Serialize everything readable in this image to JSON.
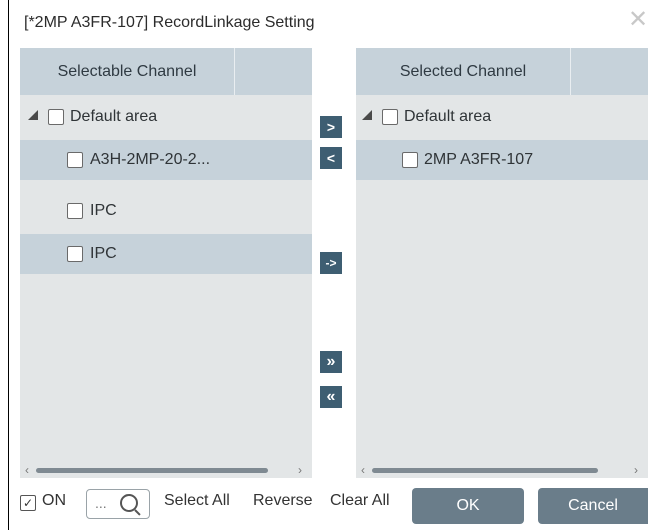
{
  "window": {
    "title": "[*2MP A3FR-107] RecordLinkage Setting",
    "close_glyph": "✕"
  },
  "left_panel": {
    "header": "Selectable Channel",
    "items": [
      {
        "label": "Default area"
      },
      {
        "label": "A3H-2MP-20-2..."
      },
      {
        "label": "IPC"
      },
      {
        "label": "IPC"
      }
    ]
  },
  "right_panel": {
    "header": "Selected Channel",
    "items": [
      {
        "label": "Default area"
      },
      {
        "label": "2MP A3FR-107"
      }
    ]
  },
  "middle_buttons": {
    "add": ">",
    "remove": "<",
    "move": "->",
    "add_all": "»",
    "remove_all": "«"
  },
  "footer": {
    "on_label": "ON",
    "search_placeholder": "...",
    "select_all": "Select All",
    "reverse": "Reverse",
    "clear_all": "Clear All",
    "ok": "OK",
    "cancel": "Cancel"
  },
  "icons": {
    "scroll_left": "‹",
    "scroll_right": "›",
    "check": "✓"
  },
  "colors": {
    "header_bg": "#c6d2da",
    "panel_bg": "#e3e6e7",
    "nav_button_bg": "#3e5e72",
    "action_button_bg": "#6a7d8a"
  }
}
